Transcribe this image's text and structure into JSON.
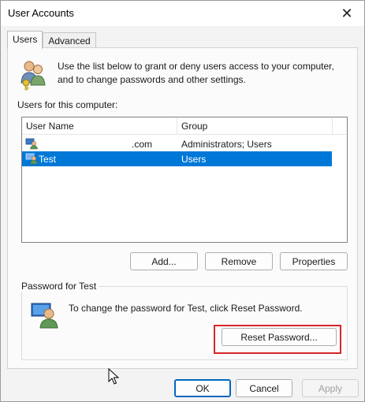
{
  "window": {
    "title": "User Accounts"
  },
  "tabs": [
    {
      "label": "Users",
      "active": true
    },
    {
      "label": "Advanced",
      "active": false
    }
  ],
  "intro": {
    "line1": "Use the list below to grant or deny users access to your computer,",
    "line2": "and to change passwords and other settings."
  },
  "users_list": {
    "caption": "Users for this computer:",
    "columns": [
      "User Name",
      "Group"
    ],
    "rows": [
      {
        "user": ".com",
        "group": "Administrators; Users",
        "selected": false
      },
      {
        "user": "Test",
        "group": "Users",
        "selected": true
      }
    ]
  },
  "list_buttons": {
    "add": "Add...",
    "remove": "Remove",
    "properties": "Properties"
  },
  "password_group": {
    "title": "Password for Test",
    "message": "To change the password for Test, click Reset Password.",
    "reset_button": "Reset Password..."
  },
  "dialog_buttons": {
    "ok": "OK",
    "cancel": "Cancel",
    "apply": "Apply"
  },
  "colors": {
    "selection": "#0078d7",
    "highlight_box": "#d7262b",
    "default_button_border": "#0067c0"
  },
  "icons": {
    "intro": "users-keys-icon",
    "row": "user-account-icon",
    "password": "user-password-icon",
    "close": "close-icon",
    "cursor": "mouse-pointer-icon"
  }
}
